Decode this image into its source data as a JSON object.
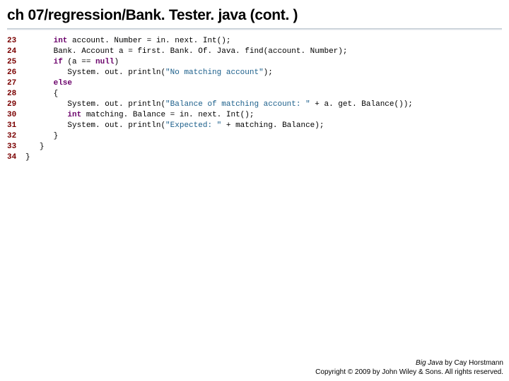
{
  "title": "ch 07/regression/Bank. Tester. java (cont. )",
  "code": {
    "lines": [
      {
        "ln": "23",
        "indent": "      ",
        "tokens": [
          {
            "t": "kw",
            "v": "int"
          },
          {
            "t": "p",
            "v": " account. Number = in. next. Int();"
          }
        ]
      },
      {
        "ln": "24",
        "indent": "      ",
        "tokens": [
          {
            "t": "p",
            "v": "Bank. Account a = first. Bank. Of. Java. find(account. Number);"
          }
        ]
      },
      {
        "ln": "25",
        "indent": "      ",
        "tokens": [
          {
            "t": "kw",
            "v": "if"
          },
          {
            "t": "p",
            "v": " (a == "
          },
          {
            "t": "kw",
            "v": "null"
          },
          {
            "t": "p",
            "v": ")"
          }
        ]
      },
      {
        "ln": "26",
        "indent": "         ",
        "tokens": [
          {
            "t": "p",
            "v": "System. out. println("
          },
          {
            "t": "str",
            "v": "\"No matching account\""
          },
          {
            "t": "p",
            "v": ");"
          }
        ]
      },
      {
        "ln": "27",
        "indent": "      ",
        "tokens": [
          {
            "t": "kw",
            "v": "else"
          }
        ]
      },
      {
        "ln": "28",
        "indent": "      ",
        "tokens": [
          {
            "t": "p",
            "v": "{"
          }
        ]
      },
      {
        "ln": "29",
        "indent": "         ",
        "tokens": [
          {
            "t": "p",
            "v": "System. out. println("
          },
          {
            "t": "str",
            "v": "\"Balance of matching account: \""
          },
          {
            "t": "p",
            "v": " + a. get. Balance());"
          }
        ]
      },
      {
        "ln": "30",
        "indent": "         ",
        "tokens": [
          {
            "t": "kw",
            "v": "int"
          },
          {
            "t": "p",
            "v": " matching. Balance = in. next. Int();"
          }
        ]
      },
      {
        "ln": "31",
        "indent": "         ",
        "tokens": [
          {
            "t": "p",
            "v": "System. out. println("
          },
          {
            "t": "str",
            "v": "\"Expected: \""
          },
          {
            "t": "p",
            "v": " + matching. Balance);"
          }
        ]
      },
      {
        "ln": "32",
        "indent": "      ",
        "tokens": [
          {
            "t": "p",
            "v": "}"
          }
        ]
      },
      {
        "ln": "33",
        "indent": "   ",
        "tokens": [
          {
            "t": "p",
            "v": "}"
          }
        ]
      },
      {
        "ln": "34",
        "indent": "",
        "tokens": [
          {
            "t": "p",
            "v": "}"
          }
        ]
      }
    ]
  },
  "footer": {
    "book": "Big Java",
    "byline": " by Cay Horstmann",
    "copyright": "Copyright © 2009 by John Wiley & Sons.  All rights reserved."
  }
}
